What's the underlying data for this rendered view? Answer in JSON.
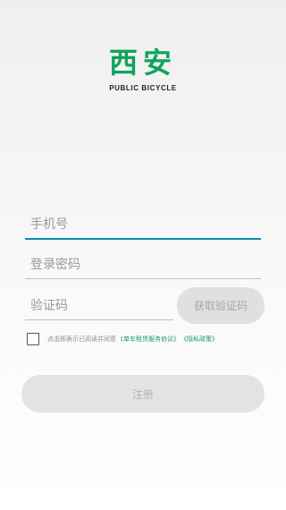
{
  "logo": {
    "title": "西安",
    "subtitle": "PUBLIC BICYCLE"
  },
  "form": {
    "phone_placeholder": "手机号",
    "password_placeholder": "登录密码",
    "code_placeholder": "验证码",
    "get_code_label": "获取验证码"
  },
  "agreement": {
    "checked": false,
    "text": "点击即表示已阅读并同意",
    "link_rental": "《单车租赁服务协议》",
    "link_privacy": "《隐私政策》"
  },
  "register_label": "注册",
  "colors": {
    "brand_green": "#11a35c",
    "focus_underline": "#0e8aa8",
    "link_green": "#1a9b60"
  }
}
